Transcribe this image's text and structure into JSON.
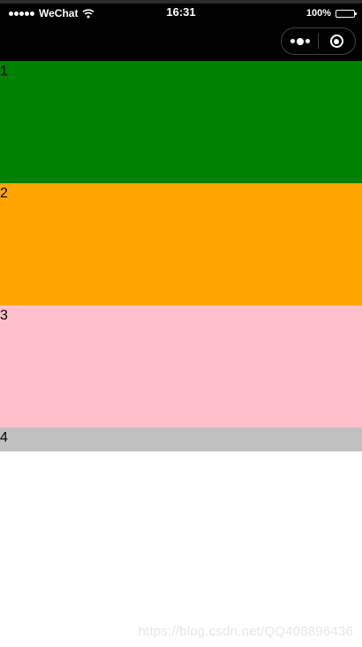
{
  "status_bar": {
    "carrier": "WeChat",
    "time": "16:31",
    "battery_percent": "100%",
    "battery_level": 1.0,
    "signal_icon": "signal-dots-icon",
    "wifi_icon": "wifi-icon"
  },
  "nav_capsule": {
    "more_icon": "more-dots-icon",
    "close_icon": "close-circle-icon"
  },
  "blocks": [
    {
      "label": "1",
      "color": "#008000"
    },
    {
      "label": "2",
      "color": "#ffa500"
    },
    {
      "label": "3",
      "color": "#ffc0cb"
    },
    {
      "label": "4",
      "color": "#c0c0c0"
    }
  ],
  "watermark": "https://blog.csdn.net/QQ408896436"
}
